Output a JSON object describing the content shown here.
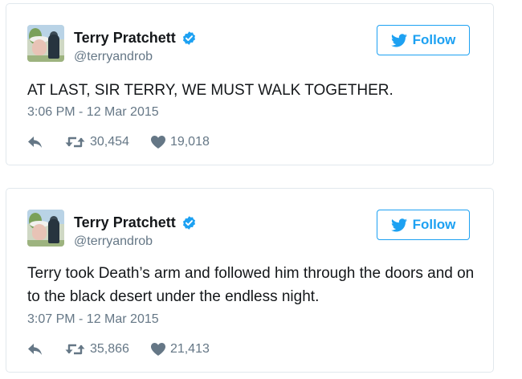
{
  "colors": {
    "accent": "#1da1f2",
    "text": "#14171a",
    "muted": "#657786",
    "border": "#e1e8ed",
    "icon": "#657786"
  },
  "tweets": [
    {
      "display_name": "Terry Pratchett",
      "handle": "@terryandrob",
      "follow_label": "Follow",
      "text": "AT LAST, SIR TERRY, WE MUST WALK TOGETHER.",
      "timestamp": "3:06 PM - 12 Mar 2015",
      "retweets": "30,454",
      "likes": "19,018",
      "icons": [
        "avatar",
        "verified-badge-icon",
        "twitter-bird-icon",
        "reply-icon",
        "retweet-icon",
        "heart-icon"
      ]
    },
    {
      "display_name": "Terry Pratchett",
      "handle": "@terryandrob",
      "follow_label": "Follow",
      "text": "Terry took Death’s arm and followed him through the doors and on to the black desert under the endless night.",
      "timestamp": "3:07 PM - 12 Mar 2015",
      "retweets": "35,866",
      "likes": "21,413",
      "icons": [
        "avatar",
        "verified-badge-icon",
        "twitter-bird-icon",
        "reply-icon",
        "retweet-icon",
        "heart-icon"
      ]
    }
  ]
}
